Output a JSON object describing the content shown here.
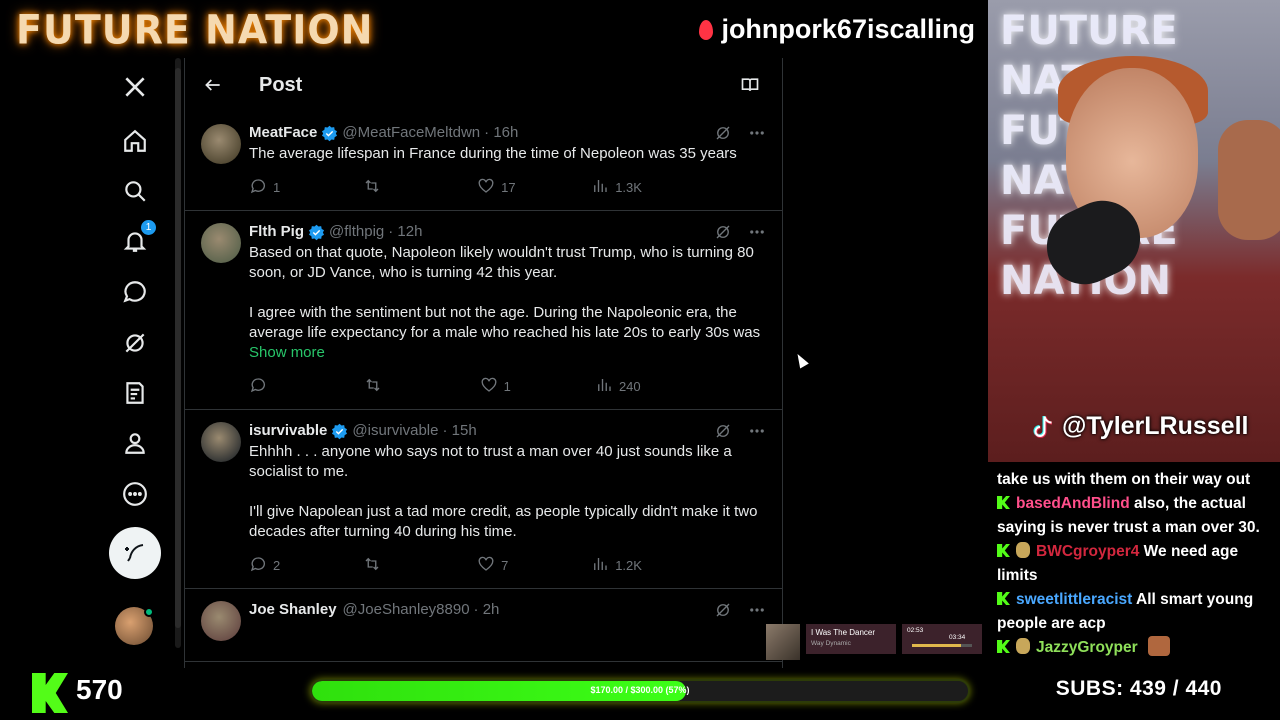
{
  "overlay": {
    "brand": "FUTURE NATION",
    "handle": "johnpork67iscalling",
    "cam_handle": "@TylerLRussell",
    "cam_bg_text": [
      "FUTURE NATION",
      "FUTURE NATION",
      "FUTURE NATION"
    ],
    "followers": "570",
    "goal_label": "$170.00 / $300.00 (57%)",
    "goal_fraction": 0.57,
    "subs": "SUBS:  439 / 440"
  },
  "nav": {
    "notifications_badge": "1",
    "icons": [
      "x-logo-icon",
      "home-icon",
      "search-icon",
      "bell-icon",
      "messages-icon",
      "grok-icon",
      "lists-icon",
      "profile-icon",
      "more-icon"
    ]
  },
  "header": {
    "title": "Post"
  },
  "tweets": [
    {
      "name": "MeatFace",
      "handle": "@MeatFaceMeltdwn",
      "time": "· 16h",
      "verified": true,
      "text": "The average lifespan in France during the time of Nepoleon was 35 years",
      "replies": "1",
      "retweets": "",
      "likes": "17",
      "views": "1.3K",
      "avatar_color": "#3b3420"
    },
    {
      "name": "Flth Pig",
      "handle": "@flthpig",
      "time": "· 12h",
      "verified": true,
      "text": "Based on that quote, Napoleon likely wouldn't trust Trump, who is turning 80 soon, or JD Vance, who is turning 42 this year.\n\nI agree with the sentiment but not the age. During the Napoleonic era, the average life expectancy for a male who reached his late 20s to early 30s was",
      "show_more": "Show more",
      "replies": "",
      "retweets": "",
      "likes": "1",
      "views": "240",
      "avatar_color": "#4a5a44"
    },
    {
      "name": "isurvivable",
      "handle": "@isurvivable",
      "time": "· 15h",
      "verified": true,
      "text": "Ehhhh . . . anyone who says not to trust a man over 40 just sounds like a socialist to me.\n\nI'll give Napolean just a tad more credit, as people typically didn't make it two decades after turning 40 during his time.",
      "replies": "2",
      "retweets": "",
      "likes": "7",
      "views": "1.2K",
      "avatar_color": "#101820"
    },
    {
      "name": "Joe Shanley",
      "handle": "@JoeShanley8890",
      "time": "· 2h",
      "verified": false,
      "text": "",
      "avatar_color": "#5a3a3a"
    }
  ],
  "chat": [
    {
      "badge": "none",
      "user": "",
      "user_class": "",
      "msg": "take us with them on their way out"
    },
    {
      "badge": "kick",
      "user": "basedAndBlind",
      "user_class": "u1",
      "msg": "also, the actual saying is never trust a man over 30."
    },
    {
      "badge": "kick+emote",
      "user": "BWCgroyper4",
      "user_class": "u2",
      "msg": "We need age limits"
    },
    {
      "badge": "kick",
      "user": "sweetlittleracist",
      "user_class": "u3",
      "msg": "All smart young people are acp"
    },
    {
      "badge": "kick+emote",
      "user": "JazzyGroyper",
      "user_class": "u4",
      "msg": ""
    }
  ],
  "player": {
    "title": "I Was The Dancer",
    "artist": "Way Dynamic",
    "elapsed": "02:53",
    "total": "03:34",
    "progress": 0.81
  }
}
